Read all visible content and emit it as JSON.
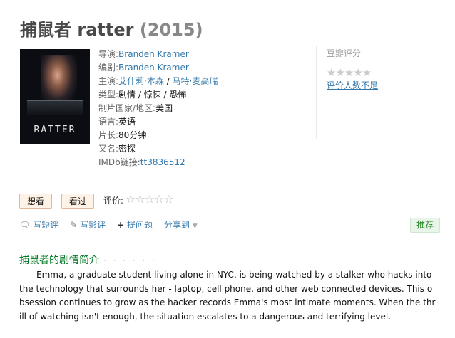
{
  "page": {
    "title": "捕鼠者 ratter",
    "year": "(2015)"
  },
  "poster": {
    "title_text": "RATTER"
  },
  "info": {
    "director_label": "导演:",
    "director": "Branden Kramer",
    "writer_label": "编剧:",
    "writer": "Branden Kramer",
    "cast_label": "主演:",
    "cast": [
      "艾什莉·本森",
      "马特·麦高瑞"
    ],
    "cast_sep": " / ",
    "genre_label": "类型:",
    "genre": "剧情 / 惊悚 / 恐怖",
    "country_label": "制片国家/地区:",
    "country": "美国",
    "language_label": "语言:",
    "language": "英语",
    "runtime_label": "片长:",
    "runtime": "80分钟",
    "aka_label": "又名:",
    "aka": "密探",
    "imdb_label": "IMDb链接:",
    "imdb": "tt3836512"
  },
  "rating": {
    "title": "豆瓣评分",
    "stars": "★★★★★",
    "note": "评价人数不足"
  },
  "actions": {
    "want_label": "想看",
    "seen_label": "看过",
    "my_rating_label": "评价:",
    "my_stars": "☆☆☆☆☆",
    "short_review": "写短评",
    "review": "写影评",
    "question": "提问题",
    "share": "分享到",
    "recommend": "推荐"
  },
  "icons": {
    "short_review_icon": "speech-bubble-icon",
    "review_icon": "pencil-icon",
    "question_icon": "plus-icon",
    "share_icon": "caret-down-icon"
  },
  "summary": {
    "title": "捕鼠者的剧情简介",
    "dots": "· · · · · ·",
    "text": "Emma, a graduate student living alone in NYC, is being watched by a stalker who hacks into the technology that surrounds her - laptop, cell phone, and other web connected devices. This obsession continues to grow as the hacker records Emma's most intimate moments. When the thrill of watching isn't enough, the situation escalates to a dangerous and terrifying level."
  },
  "colors": {
    "link": "#3377aa",
    "section_title": "#007722",
    "button_bg": "#fff2e6",
    "recommend_bg": "#e9f5e9"
  }
}
